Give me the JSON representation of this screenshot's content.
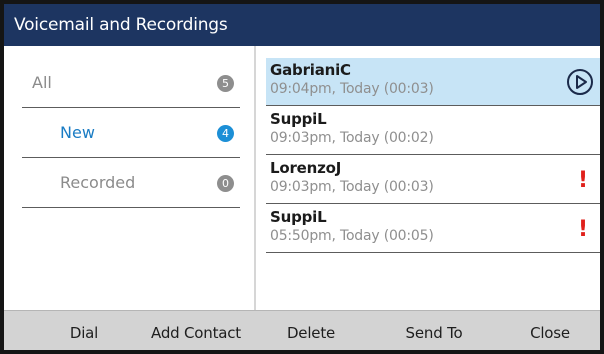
{
  "title": "Voicemail and Recordings",
  "categories": [
    {
      "label": "All",
      "count": "5",
      "active": false
    },
    {
      "label": "New",
      "count": "4",
      "active": true
    },
    {
      "label": "Recorded",
      "count": "0",
      "active": false
    }
  ],
  "messages": [
    {
      "name": "GabrianiC",
      "meta": "09:04pm, Today (00:03)",
      "selected": true,
      "icon": "play-icon"
    },
    {
      "name": "SuppiL",
      "meta": "09:03pm, Today (00:02)",
      "selected": false,
      "icon": ""
    },
    {
      "name": "LorenzoJ",
      "meta": "09:03pm, Today (00:03)",
      "selected": false,
      "icon": "urgent-icon",
      "flag": "!"
    },
    {
      "name": "SuppiL",
      "meta": "05:50pm, Today (00:05)",
      "selected": false,
      "icon": "urgent-icon",
      "flag": "!"
    }
  ],
  "softkeys": {
    "dial": "Dial",
    "add_contact": "Add Contact",
    "delete": "Delete",
    "send_to": "Send To",
    "close": "Close"
  },
  "colors": {
    "titlebar": "#1d3561",
    "accent": "#1a7cc4",
    "selected_row": "#c7e4f6",
    "urgent": "#e0201b",
    "softkey_bar": "#d3d3d3"
  }
}
